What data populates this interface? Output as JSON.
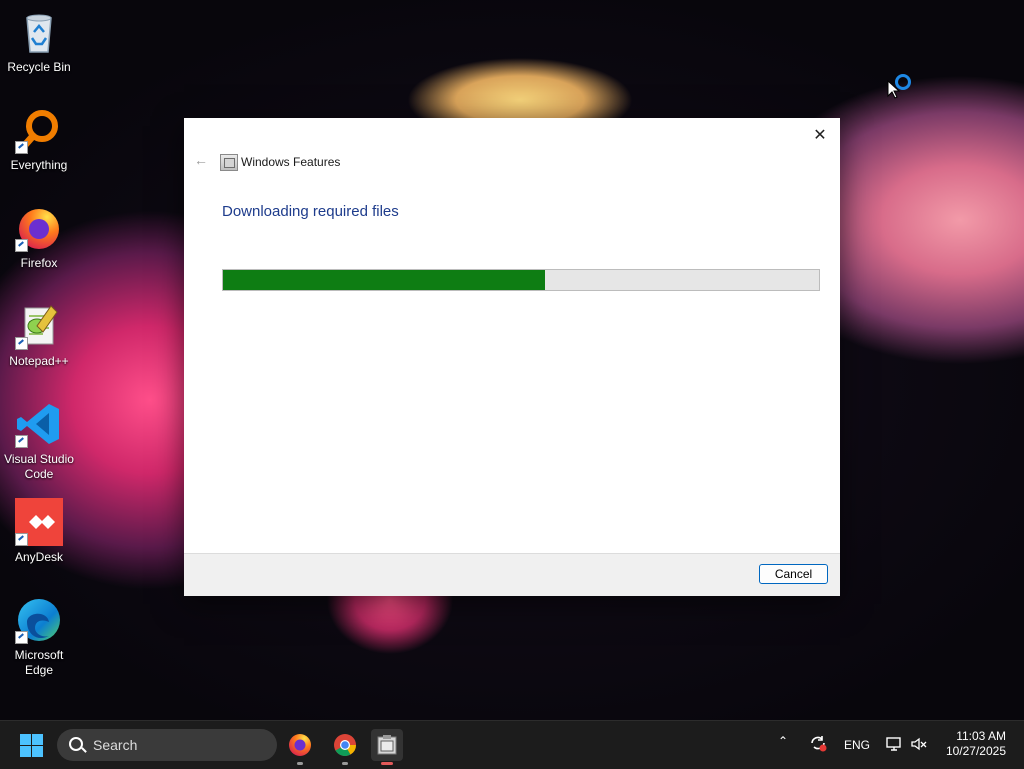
{
  "desktop": {
    "icons": [
      {
        "label": "Recycle Bin",
        "icon": "recycle-bin-icon"
      },
      {
        "label": "Everything",
        "icon": "everything-search-icon"
      },
      {
        "label": "Firefox",
        "icon": "firefox-icon"
      },
      {
        "label": "Notepad++",
        "icon": "notepadpp-icon"
      },
      {
        "label": "Visual Studio Code",
        "icon": "vscode-icon"
      },
      {
        "label": "AnyDesk",
        "icon": "anydesk-icon"
      },
      {
        "label": "Microsoft Edge",
        "icon": "edge-icon"
      }
    ]
  },
  "dialog": {
    "title": "Windows Features",
    "heading": "Downloading required files",
    "progress": 0.54,
    "cancel_label": "Cancel",
    "colors": {
      "progress_fill": "#0e7d13",
      "heading": "#1e3c8c",
      "accent": "#0067c0"
    }
  },
  "taskbar": {
    "search_placeholder": "Search",
    "apps": [
      "firefox-icon",
      "chrome-icon",
      "windows-features-icon"
    ],
    "tray": {
      "language": "ENG",
      "time": "11:03 AM",
      "date": "10/27/2025"
    }
  }
}
